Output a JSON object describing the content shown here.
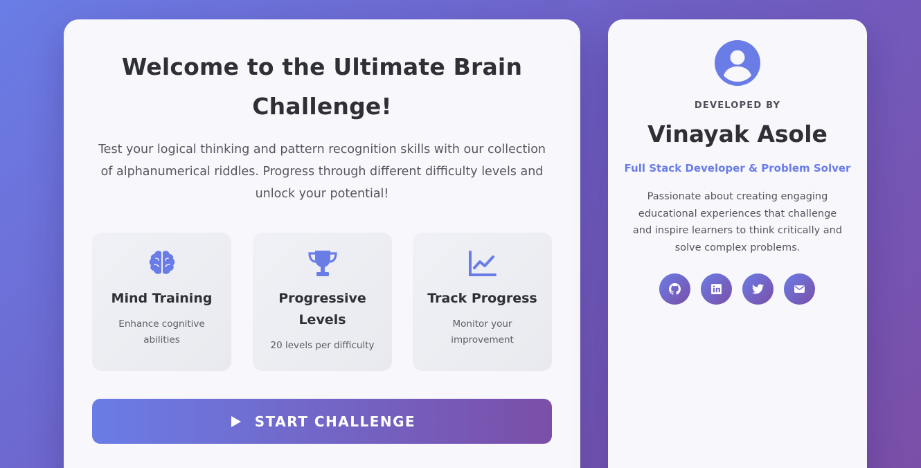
{
  "main": {
    "title": "Welcome to the Ultimate Brain Challenge!",
    "description": "Test your logical thinking and pattern recognition skills with our collection of alphanumerical riddles. Progress through different difficulty levels and unlock your potential!",
    "features": [
      {
        "icon": "brain-icon",
        "title": "Mind Training",
        "text": "Enhance cognitive abilities"
      },
      {
        "icon": "trophy-icon",
        "title": "Progressive Levels",
        "text": "20 levels per difficulty"
      },
      {
        "icon": "chart-line-icon",
        "title": "Track Progress",
        "text": "Monitor your improvement"
      }
    ],
    "start_button": {
      "icon": "play-icon",
      "label": "START CHALLENGE"
    }
  },
  "developer": {
    "avatar_icon": "user-circle-icon",
    "label": "DEVELOPED BY",
    "name": "Vinayak Asole",
    "role": "Full Stack Developer & Problem Solver",
    "bio": "Passionate about creating engaging educational experiences that challenge and inspire learners to think critically and solve complex problems.",
    "social": [
      {
        "icon": "github-icon"
      },
      {
        "icon": "linkedin-icon"
      },
      {
        "icon": "twitter-icon"
      },
      {
        "icon": "email-icon"
      }
    ]
  },
  "colors": {
    "accent": "#6a7de6",
    "accent_end": "#7a4fa8",
    "text_dark": "#2f2f36",
    "card_bg": "#f7f7fc"
  }
}
